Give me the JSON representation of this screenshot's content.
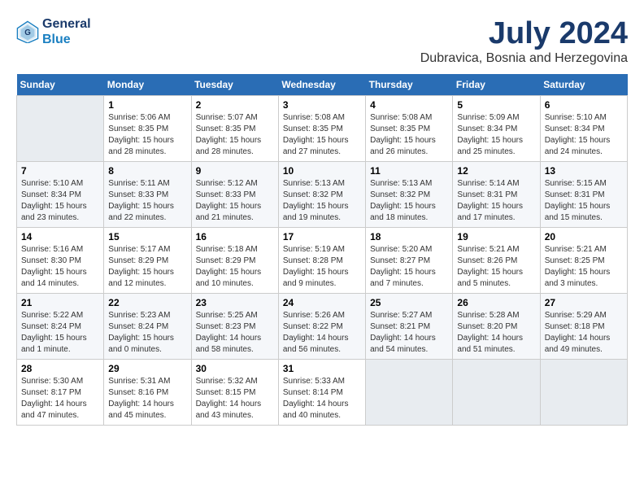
{
  "logo": {
    "line1": "General",
    "line2": "Blue"
  },
  "title": "July 2024",
  "location": "Dubravica, Bosnia and Herzegovina",
  "weekdays": [
    "Sunday",
    "Monday",
    "Tuesday",
    "Wednesday",
    "Thursday",
    "Friday",
    "Saturday"
  ],
  "weeks": [
    [
      {
        "day": "",
        "info": ""
      },
      {
        "day": "1",
        "info": "Sunrise: 5:06 AM\nSunset: 8:35 PM\nDaylight: 15 hours\nand 28 minutes."
      },
      {
        "day": "2",
        "info": "Sunrise: 5:07 AM\nSunset: 8:35 PM\nDaylight: 15 hours\nand 28 minutes."
      },
      {
        "day": "3",
        "info": "Sunrise: 5:08 AM\nSunset: 8:35 PM\nDaylight: 15 hours\nand 27 minutes."
      },
      {
        "day": "4",
        "info": "Sunrise: 5:08 AM\nSunset: 8:35 PM\nDaylight: 15 hours\nand 26 minutes."
      },
      {
        "day": "5",
        "info": "Sunrise: 5:09 AM\nSunset: 8:34 PM\nDaylight: 15 hours\nand 25 minutes."
      },
      {
        "day": "6",
        "info": "Sunrise: 5:10 AM\nSunset: 8:34 PM\nDaylight: 15 hours\nand 24 minutes."
      }
    ],
    [
      {
        "day": "7",
        "info": "Sunrise: 5:10 AM\nSunset: 8:34 PM\nDaylight: 15 hours\nand 23 minutes."
      },
      {
        "day": "8",
        "info": "Sunrise: 5:11 AM\nSunset: 8:33 PM\nDaylight: 15 hours\nand 22 minutes."
      },
      {
        "day": "9",
        "info": "Sunrise: 5:12 AM\nSunset: 8:33 PM\nDaylight: 15 hours\nand 21 minutes."
      },
      {
        "day": "10",
        "info": "Sunrise: 5:13 AM\nSunset: 8:32 PM\nDaylight: 15 hours\nand 19 minutes."
      },
      {
        "day": "11",
        "info": "Sunrise: 5:13 AM\nSunset: 8:32 PM\nDaylight: 15 hours\nand 18 minutes."
      },
      {
        "day": "12",
        "info": "Sunrise: 5:14 AM\nSunset: 8:31 PM\nDaylight: 15 hours\nand 17 minutes."
      },
      {
        "day": "13",
        "info": "Sunrise: 5:15 AM\nSunset: 8:31 PM\nDaylight: 15 hours\nand 15 minutes."
      }
    ],
    [
      {
        "day": "14",
        "info": "Sunrise: 5:16 AM\nSunset: 8:30 PM\nDaylight: 15 hours\nand 14 minutes."
      },
      {
        "day": "15",
        "info": "Sunrise: 5:17 AM\nSunset: 8:29 PM\nDaylight: 15 hours\nand 12 minutes."
      },
      {
        "day": "16",
        "info": "Sunrise: 5:18 AM\nSunset: 8:29 PM\nDaylight: 15 hours\nand 10 minutes."
      },
      {
        "day": "17",
        "info": "Sunrise: 5:19 AM\nSunset: 8:28 PM\nDaylight: 15 hours\nand 9 minutes."
      },
      {
        "day": "18",
        "info": "Sunrise: 5:20 AM\nSunset: 8:27 PM\nDaylight: 15 hours\nand 7 minutes."
      },
      {
        "day": "19",
        "info": "Sunrise: 5:21 AM\nSunset: 8:26 PM\nDaylight: 15 hours\nand 5 minutes."
      },
      {
        "day": "20",
        "info": "Sunrise: 5:21 AM\nSunset: 8:25 PM\nDaylight: 15 hours\nand 3 minutes."
      }
    ],
    [
      {
        "day": "21",
        "info": "Sunrise: 5:22 AM\nSunset: 8:24 PM\nDaylight: 15 hours\nand 1 minute."
      },
      {
        "day": "22",
        "info": "Sunrise: 5:23 AM\nSunset: 8:24 PM\nDaylight: 15 hours\nand 0 minutes."
      },
      {
        "day": "23",
        "info": "Sunrise: 5:25 AM\nSunset: 8:23 PM\nDaylight: 14 hours\nand 58 minutes."
      },
      {
        "day": "24",
        "info": "Sunrise: 5:26 AM\nSunset: 8:22 PM\nDaylight: 14 hours\nand 56 minutes."
      },
      {
        "day": "25",
        "info": "Sunrise: 5:27 AM\nSunset: 8:21 PM\nDaylight: 14 hours\nand 54 minutes."
      },
      {
        "day": "26",
        "info": "Sunrise: 5:28 AM\nSunset: 8:20 PM\nDaylight: 14 hours\nand 51 minutes."
      },
      {
        "day": "27",
        "info": "Sunrise: 5:29 AM\nSunset: 8:18 PM\nDaylight: 14 hours\nand 49 minutes."
      }
    ],
    [
      {
        "day": "28",
        "info": "Sunrise: 5:30 AM\nSunset: 8:17 PM\nDaylight: 14 hours\nand 47 minutes."
      },
      {
        "day": "29",
        "info": "Sunrise: 5:31 AM\nSunset: 8:16 PM\nDaylight: 14 hours\nand 45 minutes."
      },
      {
        "day": "30",
        "info": "Sunrise: 5:32 AM\nSunset: 8:15 PM\nDaylight: 14 hours\nand 43 minutes."
      },
      {
        "day": "31",
        "info": "Sunrise: 5:33 AM\nSunset: 8:14 PM\nDaylight: 14 hours\nand 40 minutes."
      },
      {
        "day": "",
        "info": ""
      },
      {
        "day": "",
        "info": ""
      },
      {
        "day": "",
        "info": ""
      }
    ]
  ]
}
